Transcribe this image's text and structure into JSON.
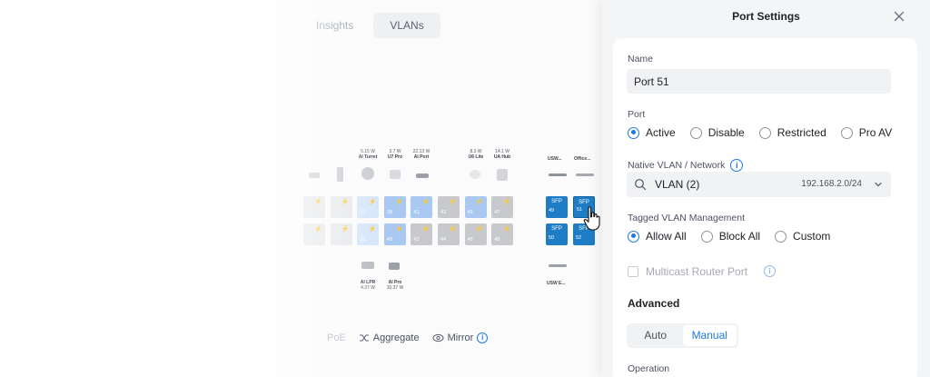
{
  "background": {
    "tabs": [
      {
        "label": "Insights",
        "active": false
      },
      {
        "label": "VLANs",
        "active": true
      }
    ],
    "devices": [
      {
        "power": "5.15 W",
        "name": "AI Turret"
      },
      {
        "power": "3.7 W",
        "name": "U7 Pro"
      },
      {
        "power": "22.13 W",
        "name": "AI Port"
      },
      {
        "power": "8.3 W",
        "name": "U6 Lite"
      },
      {
        "power": "14.1 W",
        "name": "UA Hub"
      }
    ],
    "group_labels": {
      "usw": "USW...",
      "office": "Office..."
    },
    "bottom_devices": [
      {
        "name": "AI LPR",
        "power": "4.37 W"
      },
      {
        "name": "AI Pro",
        "power": "10.37 W"
      }
    ],
    "usw_bottom_label": "USW E...",
    "ports_row1": [
      "",
      "",
      "37",
      "39",
      "41",
      "43",
      "45",
      "47"
    ],
    "ports_row2": [
      "",
      "",
      "38",
      "40",
      "42",
      "44",
      "46",
      "48"
    ],
    "sfp_ports": [
      {
        "label": "SFP",
        "num": "49"
      },
      {
        "label": "SFP",
        "num": "51"
      },
      {
        "label": "SFP",
        "num": "50"
      },
      {
        "label": "SFP",
        "num": "52"
      }
    ],
    "actions": {
      "policies": "PoE",
      "aggregate": "Aggregate",
      "mirror": "Mirror"
    }
  },
  "panel": {
    "title": "Port Settings",
    "name_label": "Name",
    "name_value": "Port 51",
    "port_label": "Port",
    "port_options": [
      {
        "label": "Active",
        "selected": true
      },
      {
        "label": "Disable",
        "selected": false
      },
      {
        "label": "Restricted",
        "selected": false
      },
      {
        "label": "Pro AV",
        "selected": false
      }
    ],
    "native_vlan_label": "Native VLAN / Network",
    "native_vlan_value": "VLAN (2)",
    "native_vlan_subnet": "192.168.2.0/24",
    "tagged_label": "Tagged VLAN Management",
    "tagged_options": [
      {
        "label": "Allow All",
        "selected": true
      },
      {
        "label": "Block All",
        "selected": false
      },
      {
        "label": "Custom",
        "selected": false
      }
    ],
    "multicast_label": "Multicast Router Port",
    "advanced_title": "Advanced",
    "advanced_modes": [
      {
        "label": "Auto",
        "selected": false
      },
      {
        "label": "Manual",
        "selected": true
      }
    ],
    "operation_label": "Operation"
  },
  "colors": {
    "accent": "#1e78e6",
    "sfp_active": "#1e7dc4",
    "poe_port": "#a9c9f3",
    "idle_port": "#c7c9cd"
  }
}
